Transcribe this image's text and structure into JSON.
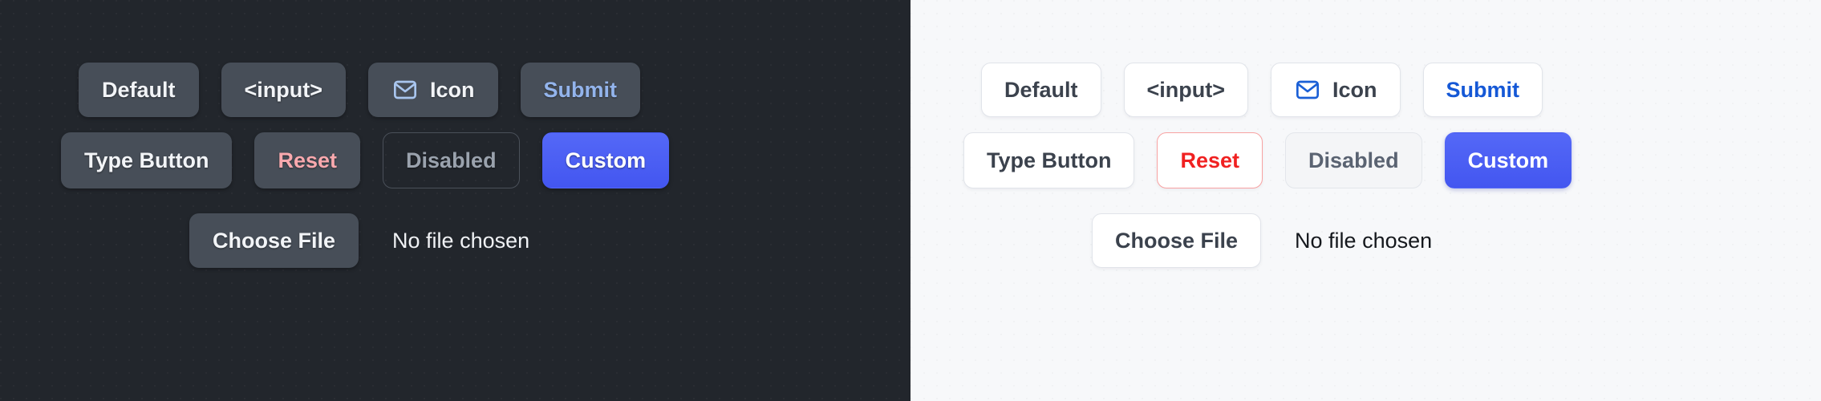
{
  "themes": {
    "dark": {
      "name": "dark-theme-panel",
      "background": "#22262c",
      "rows": [
        {
          "name": "primary-button-row",
          "buttons": [
            {
              "label": "Default",
              "variant": "default",
              "icon": null,
              "disabled": false
            },
            {
              "label": "<input>",
              "variant": "default",
              "icon": null,
              "disabled": false
            },
            {
              "label": "Icon",
              "variant": "default",
              "icon": "envelope-icon",
              "disabled": false
            },
            {
              "label": "Submit",
              "variant": "submit",
              "icon": null,
              "disabled": false
            }
          ]
        },
        {
          "name": "secondary-button-row",
          "buttons": [
            {
              "label": "Type Button",
              "variant": "default",
              "icon": null,
              "disabled": false
            },
            {
              "label": "Reset",
              "variant": "reset",
              "icon": null,
              "disabled": false
            },
            {
              "label": "Disabled",
              "variant": "disabled",
              "icon": null,
              "disabled": true
            },
            {
              "label": "Custom",
              "variant": "custom",
              "icon": null,
              "disabled": false
            }
          ]
        }
      ],
      "file_input": {
        "button_label": "Choose File",
        "status_text": "No file chosen"
      }
    },
    "light": {
      "name": "light-theme-panel",
      "background": "#f7f8fa",
      "rows": [
        {
          "name": "primary-button-row",
          "buttons": [
            {
              "label": "Default",
              "variant": "default",
              "icon": null,
              "disabled": false
            },
            {
              "label": "<input>",
              "variant": "default",
              "icon": null,
              "disabled": false
            },
            {
              "label": "Icon",
              "variant": "default",
              "icon": "envelope-icon",
              "disabled": false
            },
            {
              "label": "Submit",
              "variant": "submit",
              "icon": null,
              "disabled": false
            }
          ]
        },
        {
          "name": "secondary-button-row",
          "buttons": [
            {
              "label": "Type Button",
              "variant": "default",
              "icon": null,
              "disabled": false
            },
            {
              "label": "Reset",
              "variant": "reset",
              "icon": null,
              "disabled": false
            },
            {
              "label": "Disabled",
              "variant": "disabled",
              "icon": null,
              "disabled": true
            },
            {
              "label": "Custom",
              "variant": "custom",
              "icon": null,
              "disabled": false
            }
          ]
        }
      ],
      "file_input": {
        "button_label": "Choose File",
        "status_text": "No file chosen"
      }
    }
  },
  "colors": {
    "dark_panel_bg": "#22262c",
    "dark_button_bg": "#474e58",
    "dark_text": "#f2f4f7",
    "dark_submit_text": "#93b4ec",
    "dark_reset_text": "#f9a9ae",
    "dark_disabled_text": "#9aa2ad",
    "dark_icon_stroke": "#a9c6ef",
    "light_panel_bg": "#f7f8fa",
    "light_button_bg": "#ffffff",
    "light_border": "#e1e4ea",
    "light_text": "#3b424d",
    "light_submit_text": "#1558d6",
    "light_reset_text": "#f02121",
    "light_reset_border": "#f8a2a2",
    "light_disabled_bg": "#f4f5f7",
    "light_disabled_text": "#5a6372",
    "light_icon_stroke": "#1a5fd6",
    "custom_gradient_top": "#5468f7",
    "custom_gradient_bottom": "#4356f0"
  }
}
